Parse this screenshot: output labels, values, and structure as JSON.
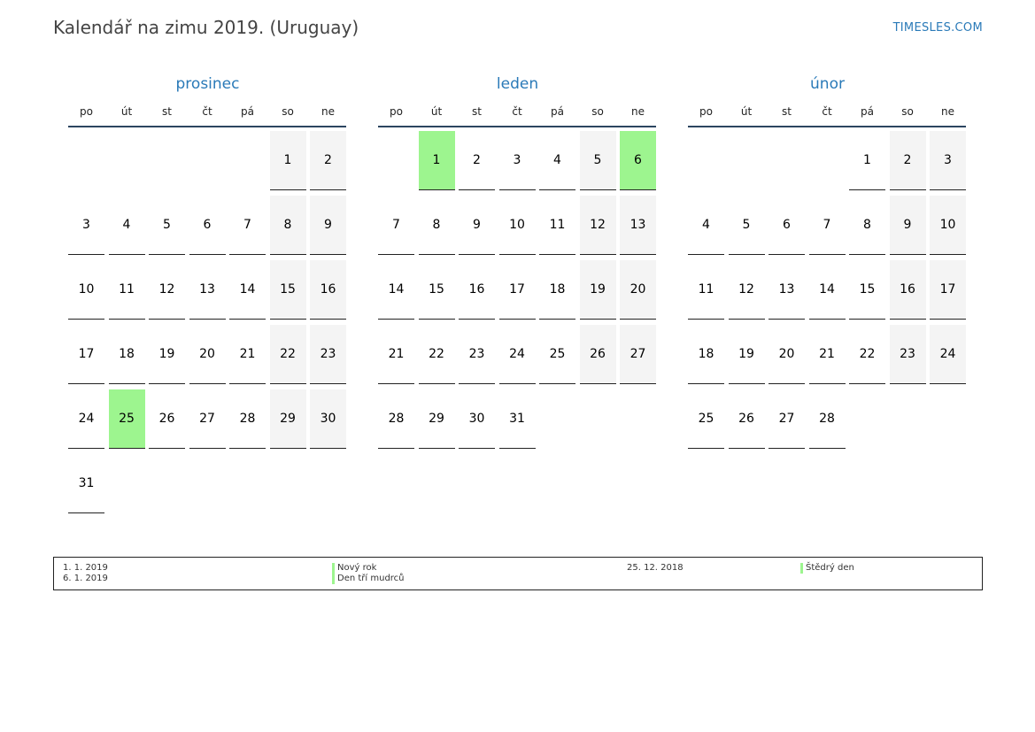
{
  "title": "Kalendář na zimu 2019. (Uruguay)",
  "site": "TIMESLES.COM",
  "colors": {
    "accent": "#2a7ab8",
    "holiday": "#9df58f",
    "weekend": "#f4f4f4"
  },
  "weekdays": [
    "po",
    "út",
    "st",
    "čt",
    "pá",
    "so",
    "ne"
  ],
  "months": [
    {
      "name": "prosinec",
      "offset": 5,
      "days": 31,
      "holidays": [
        25
      ]
    },
    {
      "name": "leden",
      "offset": 1,
      "days": 31,
      "holidays": [
        1,
        6
      ]
    },
    {
      "name": "únor",
      "offset": 4,
      "days": 28,
      "holidays": []
    }
  ],
  "legend": [
    {
      "date": "1. 1. 2019",
      "name": "Nový rok"
    },
    {
      "date": "6. 1. 2019",
      "name": "Den tří mudrců"
    },
    {
      "date": "25. 12. 2018",
      "name": "Štědrý den"
    }
  ]
}
